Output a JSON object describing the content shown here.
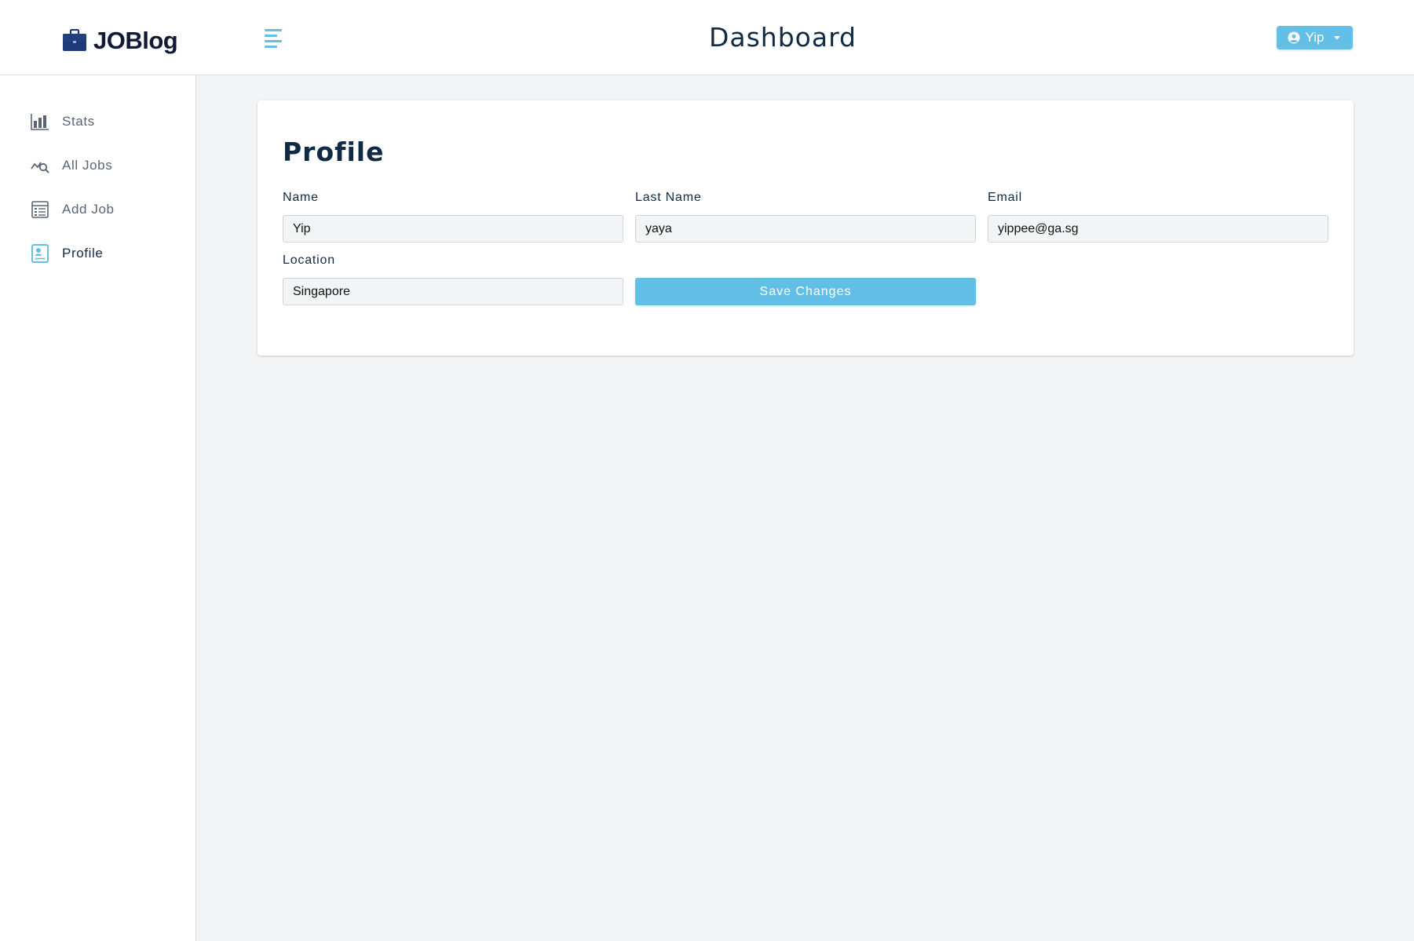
{
  "brand": {
    "name": "JOBlog"
  },
  "header": {
    "title": "Dashboard",
    "user_name": "Yip"
  },
  "sidebar": {
    "items": [
      {
        "label": "Stats",
        "icon": "bar-chart-icon",
        "active": false
      },
      {
        "label": "All Jobs",
        "icon": "search-chart-icon",
        "active": false
      },
      {
        "label": "Add Job",
        "icon": "form-icon",
        "active": false
      },
      {
        "label": "Profile",
        "icon": "profile-card-icon",
        "active": true
      }
    ]
  },
  "profile": {
    "title": "Profile",
    "name_label": "Name",
    "name_value": "Yip",
    "last_name_label": "Last Name",
    "last_name_value": "yaya",
    "email_label": "Email",
    "email_value": "yippee@ga.sg",
    "location_label": "Location",
    "location_value": "Singapore",
    "save_label": "Save Changes"
  },
  "colors": {
    "accent": "#64bfe6",
    "text_dark": "#102a43",
    "background": "#f3f4f6"
  }
}
